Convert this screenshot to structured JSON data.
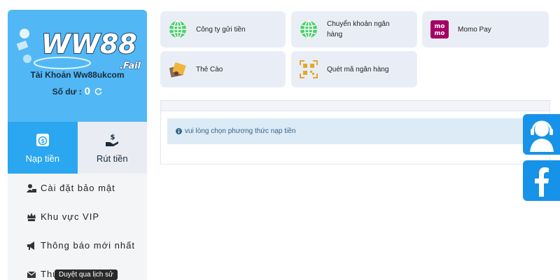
{
  "sidebar": {
    "logo_text": "WW88",
    "logo_suffix": ".Fail",
    "account_name": "Tài Khoản Ww88ukcom",
    "balance_label": "Số dư :",
    "balance_value": "0",
    "tabs": [
      {
        "label": "Nạp tiền",
        "icon": "money-bag-icon",
        "active": true
      },
      {
        "label": "Rút tiền",
        "icon": "withdraw-hand-icon",
        "active": false
      }
    ],
    "menu": [
      {
        "label": "Cài đặt bảo mật",
        "icon": "user-lock-icon"
      },
      {
        "label": "Khu vực VIP",
        "icon": "vip-crown-icon"
      },
      {
        "label": "Thông báo mới nhất",
        "icon": "megaphone-icon"
      },
      {
        "label": "Thư",
        "icon": "envelope-icon"
      }
    ],
    "tooltip": "Duyệt qua lịch sử"
  },
  "payment_methods": [
    {
      "label": "Công ty gửi tiền",
      "icon": "globe-icon"
    },
    {
      "label": "Chuyển khoản ngân hàng",
      "icon": "globe-icon"
    },
    {
      "label": "Momo Pay",
      "icon": "momo-logo-icon"
    },
    {
      "label": "Thẻ Cào",
      "icon": "scratch-card-icon"
    },
    {
      "label": "Quét mã ngân hàng",
      "icon": "qr-scan-icon"
    }
  ],
  "notice": "vui lòng chọn phương thức nạp tiền",
  "colors": {
    "profile_bg": "#52b8f5",
    "active_tab": "#2aa7f0",
    "card_bg": "#e9eef6",
    "notice_bg": "#dcebf5",
    "float_btn": "#1693e8",
    "momo": "#a50064"
  },
  "floating_buttons": [
    {
      "icon": "support-agent-icon"
    },
    {
      "icon": "facebook-icon"
    }
  ]
}
